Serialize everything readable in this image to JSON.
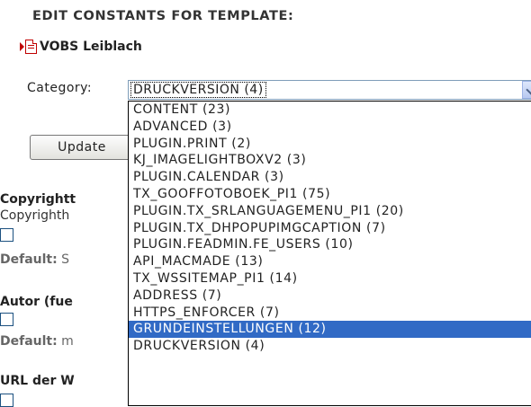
{
  "page": {
    "header": "EDIT CONSTANTS FOR TEMPLATE:",
    "template_name": "VOBS Leiblach"
  },
  "category": {
    "label": "Category:",
    "selected": "DRUCKVERSION (4)",
    "options": [
      "CONTENT (23)",
      "ADVANCED (3)",
      "PLUGIN.PRINT (2)",
      "KJ_IMAGELIGHTBOXV2 (3)",
      "PLUGIN.CALENDAR (3)",
      "TX_GOOFFOTOBOEK_PI1 (75)",
      "PLUGIN.TX_SRLANGUAGEMENU_PI1 (20)",
      "PLUGIN.TX_DHPOPUPIMGCAPTION (7)",
      "PLUGIN.FEADMIN.FE_USERS (10)",
      "API_MACMADE (13)",
      "TX_WSSITEMAP_PI1 (14)",
      "ADDRESS (7)",
      "HTTPS_ENFORCER (7)",
      "GRUNDEINSTELLUNGEN (12)",
      "DRUCKVERSION (4)"
    ],
    "highlighted_index": 13
  },
  "update_button": "Update",
  "fields": [
    {
      "title": "Copyrightt",
      "subtitle": "Copyrighth",
      "default_label": "Default:",
      "default_value": "S"
    },
    {
      "title": "Autor (fue",
      "default_label": "Default:",
      "default_value": "m"
    },
    {
      "title": "URL der W"
    }
  ],
  "colors": {
    "selection": "#316ac5",
    "select_border": "#7f9db9",
    "checkbox_border": "#1c5180",
    "icon_red": "#c00000"
  }
}
